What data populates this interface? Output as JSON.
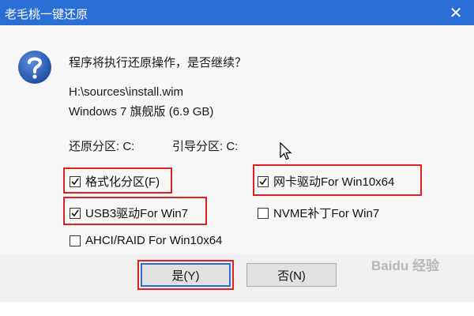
{
  "window": {
    "title": "老毛桃一键还原",
    "close_glyph": "✕"
  },
  "message": {
    "question": "程序将执行还原操作，是否继续？",
    "source_path": "H:\\sources\\install.wim",
    "image_info": "Windows 7 旗舰版 (6.9 GB)",
    "restore_partition": "还原分区: C:",
    "boot_partition": "引导分区: C:"
  },
  "options": [
    {
      "label": "格式化分区(F)",
      "checked": true
    },
    {
      "label": "网卡驱动For Win10x64",
      "checked": true
    },
    {
      "label": "USB3驱动For Win7",
      "checked": true
    },
    {
      "label": "NVME补丁For Win7",
      "checked": false
    },
    {
      "label": "AHCI/RAID For Win10x64",
      "checked": false
    }
  ],
  "buttons": {
    "yes": "是(Y)",
    "no": "否(N)"
  },
  "watermark": "Baidu 经验",
  "colors": {
    "titlebar": "#2a6fd6",
    "highlight": "#e02020",
    "question_icon": "#2b5fb3"
  },
  "icons": {
    "dialog": "question-icon",
    "close": "close-icon",
    "checkmark": "check-icon",
    "pointer": "mouse-cursor-icon"
  }
}
